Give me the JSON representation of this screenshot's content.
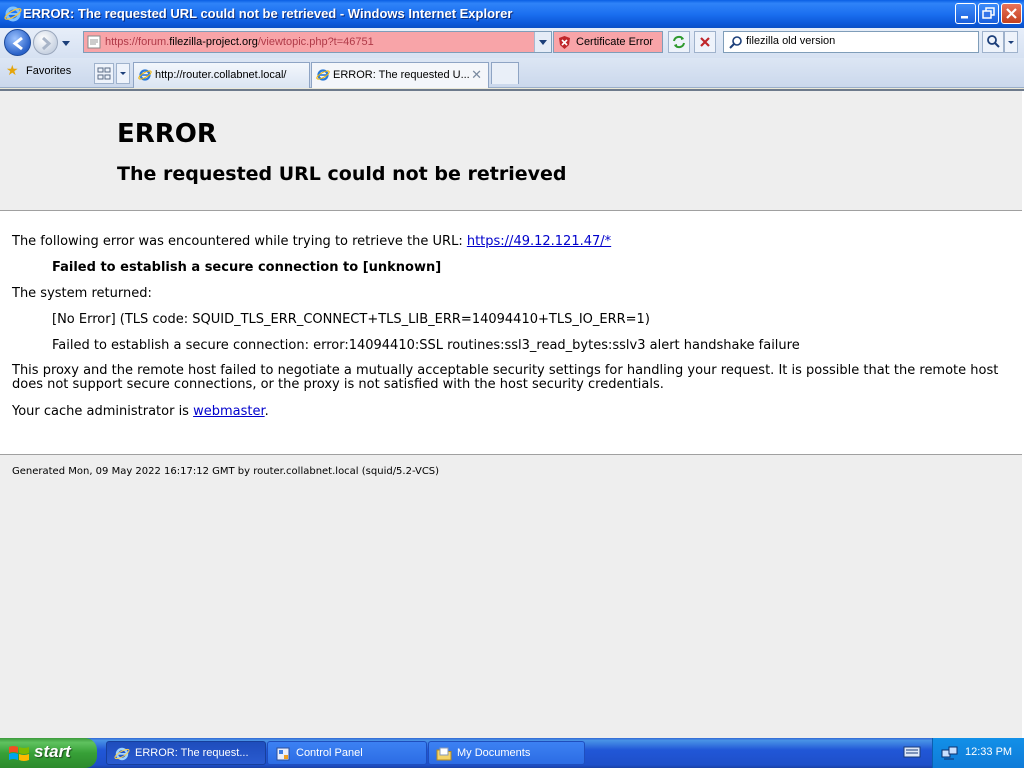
{
  "window": {
    "title": "ERROR: The requested URL could not be retrieved - Windows Internet Explorer"
  },
  "nav": {
    "url_prefix": "https://forum.",
    "url_domain": "filezilla-project.org",
    "url_suffix": "/viewtopic.php?t=46751",
    "cert_error_label": "Certificate Error",
    "search_value": "filezilla old version"
  },
  "tabs": {
    "favorites_label": "Favorites",
    "items": [
      {
        "label": "http://router.collabnet.local/"
      },
      {
        "label": "ERROR: The requested U..."
      }
    ]
  },
  "page": {
    "h1": "ERROR",
    "h2": "The requested URL could not be retrieved",
    "line1_text": "The following error was encountered while trying to retrieve the URL: ",
    "line1_link": "https://49.12.121.47/*",
    "failed_bold": "Failed to establish a secure connection to [unknown]",
    "system_returned": "The system returned:",
    "tls_code": "[No Error] (TLS code: SQUID_TLS_ERR_CONNECT+TLS_LIB_ERR=14094410+TLS_IO_ERR=1)",
    "ssl_error": "Failed to establish a secure connection: error:14094410:SSL routines:ssl3_read_bytes:sslv3 alert handshake failure",
    "explanation": "This proxy and the remote host failed to negotiate a mutually acceptable security settings for handling your request. It is possible that the remote host does not support secure connections, or the proxy is not satisfied with the host security credentials.",
    "admin_text": "Your cache administrator is ",
    "admin_link": "webmaster",
    "admin_end": ".",
    "generated": "Generated Mon, 09 May 2022 16:17:12 GMT by router.collabnet.local (squid/5.2-VCS)"
  },
  "taskbar": {
    "start_label": "start",
    "items": [
      {
        "label": "ERROR: The request...",
        "icon": "ie-icon"
      },
      {
        "label": "Control Panel",
        "icon": "control-panel-icon"
      },
      {
        "label": "My Documents",
        "icon": "folder-icon"
      }
    ],
    "clock": "12:33 PM"
  }
}
